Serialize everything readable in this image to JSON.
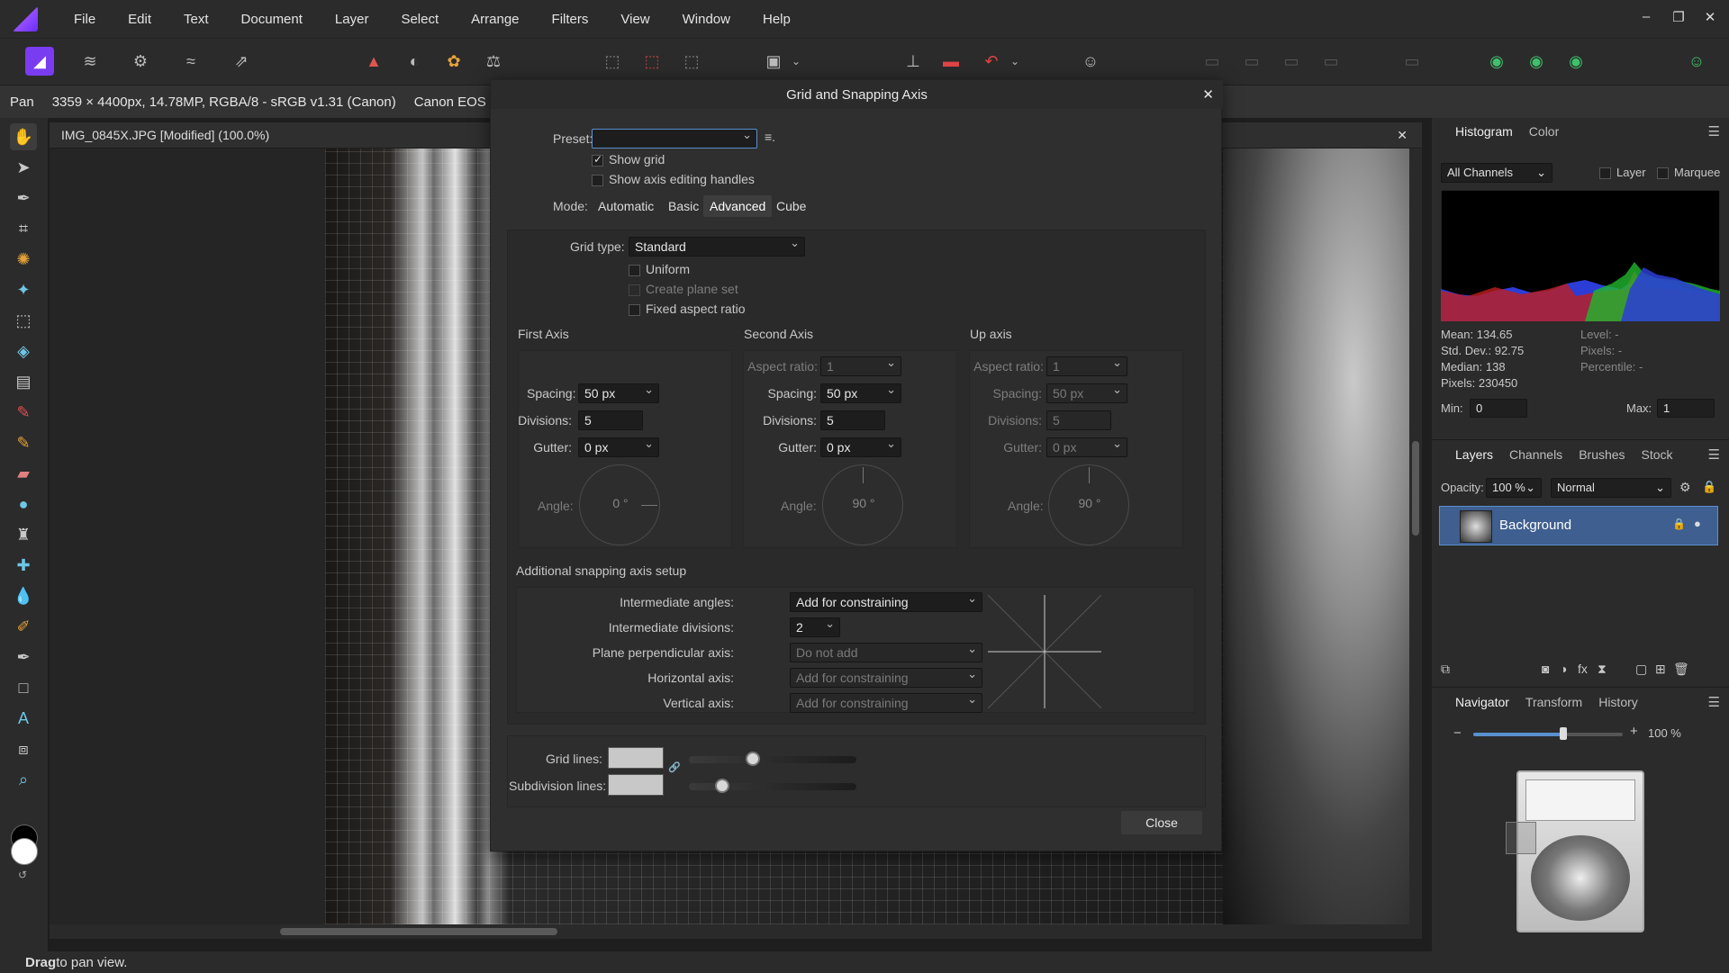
{
  "menubar": {
    "items": [
      "File",
      "Edit",
      "Text",
      "Document",
      "Layer",
      "Select",
      "Arrange",
      "Filters",
      "View",
      "Window",
      "Help"
    ]
  },
  "context": {
    "tool": "Pan",
    "image_info": "3359 × 4400px, 14.78MP, RGBA/8 - sRGB v1.31 (Canon)",
    "camera": "Canon EOS Reb"
  },
  "document": {
    "tab_title": "IMG_0845X.JPG [Modified] (100.0%)"
  },
  "status": {
    "bold": "Drag",
    "text": " to pan view."
  },
  "dialog": {
    "title": "Grid and Snapping Axis",
    "preset_label": "Preset:",
    "preset_value": "",
    "show_grid": "Show grid",
    "show_axis_handles": "Show axis editing handles",
    "mode_label": "Mode:",
    "modes": [
      "Automatic",
      "Basic",
      "Advanced",
      "Cube"
    ],
    "active_mode": "Advanced",
    "grid_type_label": "Grid type:",
    "grid_type": "Standard",
    "uniform": "Uniform",
    "create_plane_set": "Create plane set",
    "fixed_aspect": "Fixed aspect ratio",
    "first_axis": {
      "title": "First Axis",
      "spacing_label": "Spacing:",
      "spacing": "50 px",
      "divisions_label": "Divisions:",
      "divisions": "5",
      "gutter_label": "Gutter:",
      "gutter": "0 px",
      "angle_label": "Angle:",
      "angle": "0 °"
    },
    "second_axis": {
      "title": "Second Axis",
      "aspect_label": "Aspect ratio:",
      "aspect": "1",
      "spacing_label": "Spacing:",
      "spacing": "50 px",
      "divisions_label": "Divisions:",
      "divisions": "5",
      "gutter_label": "Gutter:",
      "gutter": "0 px",
      "angle_label": "Angle:",
      "angle": "90 °"
    },
    "up_axis": {
      "title": "Up axis",
      "aspect_label": "Aspect ratio:",
      "aspect": "1",
      "spacing_label": "Spacing:",
      "spacing": "50 px",
      "divisions_label": "Divisions:",
      "divisions": "5",
      "gutter_label": "Gutter:",
      "gutter": "0 px",
      "angle_label": "Angle:",
      "angle": "90 °"
    },
    "additional": {
      "title": "Additional snapping axis setup",
      "intermediate_angles_label": "Intermediate angles:",
      "intermediate_angles": "Add for constraining",
      "intermediate_divisions_label": "Intermediate divisions:",
      "intermediate_divisions": "2",
      "plane_perp_label": "Plane perpendicular axis:",
      "plane_perp": "Do not add",
      "horizontal_label": "Horizontal axis:",
      "horizontal": "Add for constraining",
      "vertical_label": "Vertical axis:",
      "vertical": "Add for constraining"
    },
    "grid_lines_label": "Grid lines:",
    "grid_lines_opacity": 0.38,
    "subdivision_lines_label": "Subdivision lines:",
    "subdivision_lines_opacity": 0.2,
    "close": "Close"
  },
  "histogram": {
    "tabs": [
      "Histogram",
      "Color"
    ],
    "channel": "All Channels",
    "layer": "Layer",
    "marquee": "Marquee",
    "mean": "Mean: 134.65",
    "std": "Std. Dev.: 92.75",
    "median": "Median: 138",
    "pixels": "Pixels: 230450",
    "level": "Level: -",
    "pixels2": "Pixels: -",
    "percentile": "Percentile: -",
    "min_label": "Min:",
    "min": "0",
    "max_label": "Max:",
    "max": "1"
  },
  "layers": {
    "tabs": [
      "Layers",
      "Channels",
      "Brushes",
      "Stock"
    ],
    "opacity_label": "Opacity:",
    "opacity": "100 %",
    "blend": "Normal",
    "layer_name": "Background"
  },
  "navigator": {
    "tabs": [
      "Navigator",
      "Transform",
      "History"
    ],
    "zoom": "100 %",
    "zoom_fraction": 0.6
  },
  "colors": {
    "accent": "#5a8fcf",
    "selected_layer": "#3e5f8f"
  }
}
